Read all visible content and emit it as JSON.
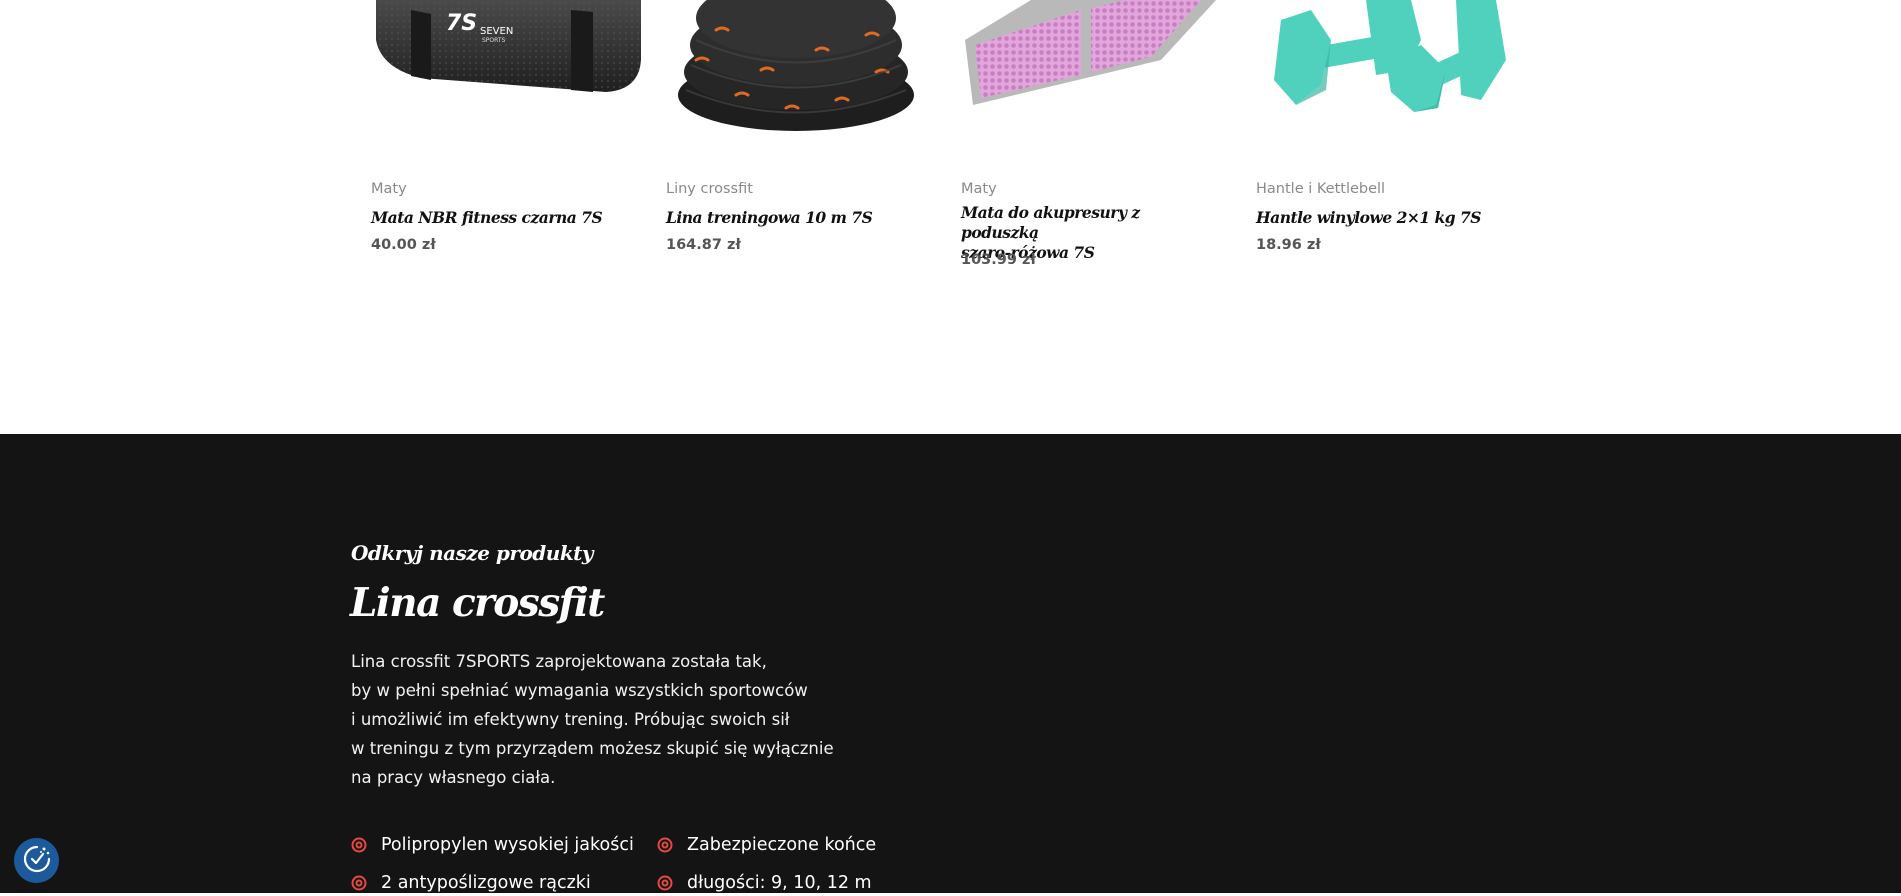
{
  "products": [
    {
      "category": "Maty",
      "name": "Mata NBR fitness czarna 7S",
      "price": "40.00 zł",
      "logo_text": "SEVEN",
      "logo_sub": "SPORTS",
      "logo_mark": "7S"
    },
    {
      "category": "Liny crossfit",
      "name": "Lina treningowa 10 m 7S",
      "price": "164.87 zł"
    },
    {
      "category": "Maty",
      "name_lines": [
        "Mata do akupresury z poduszką",
        "szaro-różowa 7S"
      ],
      "price": "103.99 zł"
    },
    {
      "category": "Hantle i Kettlebell",
      "name": "Hantle winylowe 2×1 kg 7S",
      "price": "18.96 zł"
    }
  ],
  "promo": {
    "eyebrow": "Odkryj nasze produkty",
    "title": "Lina crossfit",
    "description_lines": [
      "Lina crossfit 7SPORTS zaprojektowana została tak,",
      "by w pełni spełniać wymagania wszystkich sportowców",
      "i umożliwić im efektywny trening. Próbując swoich sił",
      "w treningu z tym przyrządem możesz skupić się wyłącznie",
      "na pracy własnego ciała."
    ],
    "features": [
      "Polipropylen wysokiej jakości",
      "Zabezpieczone końce",
      "2 antypoślizgowe rączki",
      "długości: 9, 10, 12 m"
    ],
    "feature_icon": "target-icon",
    "accent_color": "#e8483f"
  },
  "cookie": {
    "icon": "cookie-consent-icon",
    "color": "#1c5a9b"
  },
  "colors": {
    "dark_bg": "#141414",
    "mat_black": "#2c2c2c",
    "acupressure_pink": "#e2a6dc",
    "dumbbell_teal": "#4fd1bd"
  }
}
